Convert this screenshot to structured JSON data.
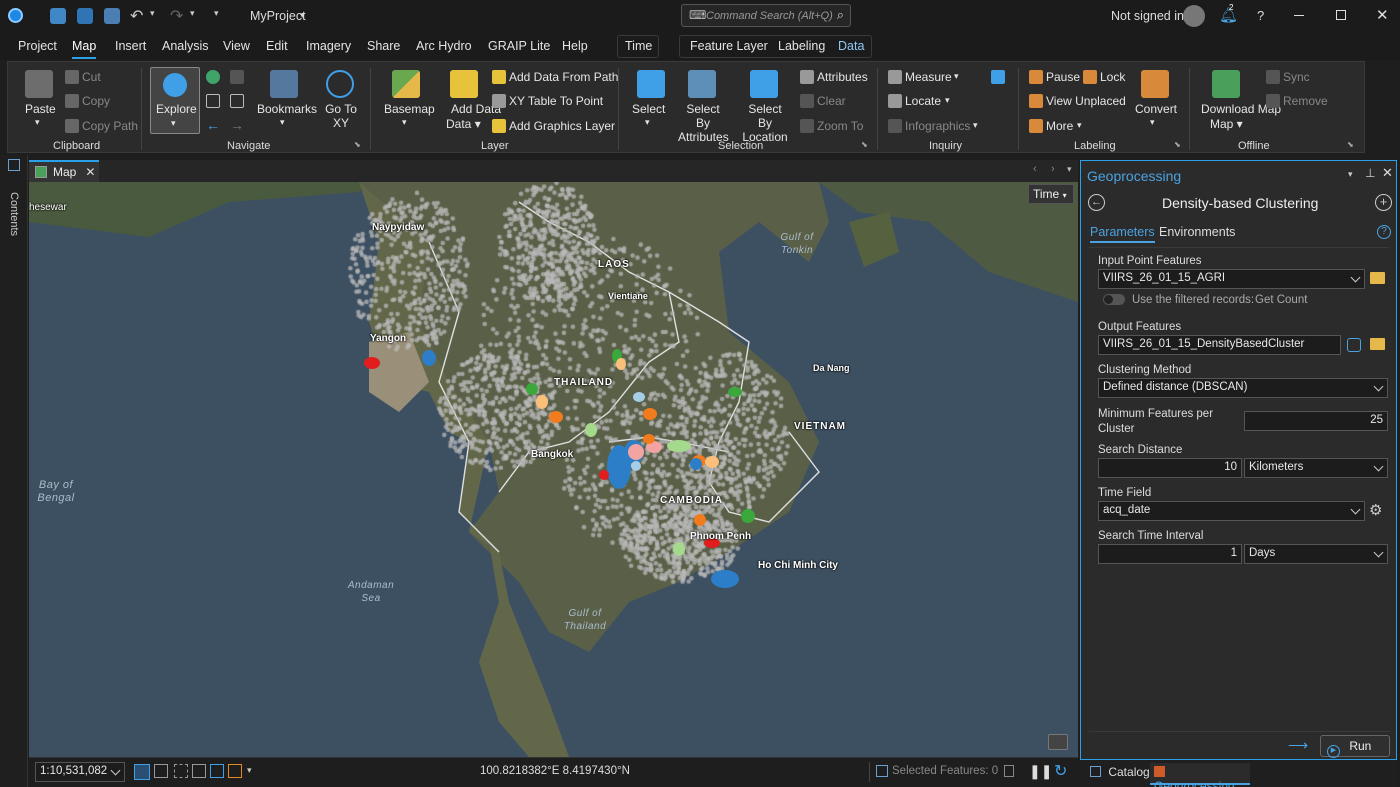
{
  "title_bar": {
    "project_name": "MyProject",
    "command_search_placeholder": "Command Search (Alt+Q)",
    "account_status": "Not signed in",
    "help_label": "?",
    "notification_badge": "2"
  },
  "menu": {
    "items": [
      "Project",
      "Map",
      "Insert",
      "Analysis",
      "View",
      "Edit",
      "Imagery",
      "Share",
      "Arc Hydro",
      "GRAIP Lite",
      "Help"
    ],
    "active": "Map",
    "context_tab": "Time",
    "context_items": [
      "Feature Layer",
      "Labeling",
      "Data"
    ],
    "context_active": "Data"
  },
  "ribbon": {
    "clipboard": {
      "group": "Clipboard",
      "paste": "Paste",
      "cut": "Cut",
      "copy": "Copy",
      "copy_path": "Copy Path"
    },
    "navigate": {
      "group": "Navigate",
      "explore": "Explore",
      "bookmarks": "Bookmarks",
      "go_to_xy": "Go To XY"
    },
    "layer": {
      "group": "Layer",
      "basemap": "Basemap",
      "add_data": "Add Data",
      "add_data_from_path": "Add Data From Path",
      "xy_table": "XY Table To Point",
      "add_graphics": "Add Graphics Layer"
    },
    "selection": {
      "group": "Selection",
      "select": "Select",
      "by_attributes": "Select By Attributes",
      "by_location": "Select By Location",
      "attributes": "Attributes",
      "clear": "Clear",
      "zoom_to": "Zoom To"
    },
    "inquiry": {
      "group": "Inquiry",
      "measure": "Measure",
      "locate": "Locate",
      "infographics": "Infographics"
    },
    "labeling": {
      "group": "Labeling",
      "pause": "Pause",
      "lock": "Lock",
      "view_unplaced": "View Unplaced",
      "more": "More",
      "convert": "Convert"
    },
    "offline": {
      "group": "Offline",
      "download_map": "Download Map",
      "sync": "Sync",
      "remove": "Remove"
    }
  },
  "sidebar": {
    "contents_label": "Contents"
  },
  "map": {
    "tab_label": "Map",
    "time_button": "Time",
    "scale": "1:10,531,082",
    "coordinates": "100.8218382°E 8.4197430°N",
    "selected_features": "Selected Features: 0",
    "places": {
      "naypyidaw": "Naypyidaw",
      "laos": "LAOS",
      "vientiane": "Vientiane",
      "yangon": "Yangon",
      "thailand": "THAILAND",
      "da_nang": "Da Nang",
      "vietnam": "VIETNAM",
      "bangkok": "Bangkok",
      "cambodia": "CAMBODIA",
      "phnom_penh": "Phnom Penh",
      "ho_chi_minh": "Ho Chi Minh City",
      "eswar": "hesewar"
    },
    "water": {
      "gulf_tonkin_1": "Gulf of",
      "gulf_tonkin_2": "Tonkin",
      "bay_bengal_1": "Bay of",
      "bay_bengal_2": "Bengal",
      "andaman_1": "Andaman",
      "andaman_2": "Sea",
      "gulf_thailand_1": "Gulf of",
      "gulf_thailand_2": "Thailand"
    }
  },
  "geoprocessing": {
    "pane_title": "Geoprocessing",
    "tool_name": "Density-based Clustering",
    "tabs": [
      "Parameters",
      "Environments"
    ],
    "active_tab": "Parameters",
    "input_label": "Input Point Features",
    "input_value": "VIIRS_26_01_15_AGRI",
    "filter_toggle_label": "Use the filtered records:",
    "get_count": "Get Count",
    "output_label": "Output Features",
    "output_value": "VIIRS_26_01_15_DensityBasedCluster",
    "method_label": "Clustering Method",
    "method_value": "Defined distance (DBSCAN)",
    "min_features_label_1": "Minimum Features per",
    "min_features_label_2": "Cluster",
    "min_features_value": "25",
    "search_distance_label": "Search Distance",
    "search_distance_value": "10",
    "search_distance_unit": "Kilometers",
    "time_field_label": "Time Field",
    "time_field_value": "acq_date",
    "time_interval_label": "Search Time Interval",
    "time_interval_value": "1",
    "time_interval_unit": "Days",
    "run_label": "Run"
  },
  "bottom_tabs": {
    "catalog": "Catalog",
    "geoprocessing": "Geoprocessing"
  },
  "colors": {
    "accent": "#2aa0e8",
    "ribbon_bg": "#2b2b2b",
    "cluster_blue": "#2c7ec9",
    "cluster_orange": "#f27c1d",
    "cluster_green": "#3aa83a",
    "cluster_red": "#e11d1d",
    "cluster_pink": "#f4a3a3",
    "cluster_lightblue": "#a6cde6",
    "cluster_lightgreen": "#a5d98b",
    "cluster_peach": "#fbbf7a",
    "hotspot_gray": "#b8b8b8"
  }
}
